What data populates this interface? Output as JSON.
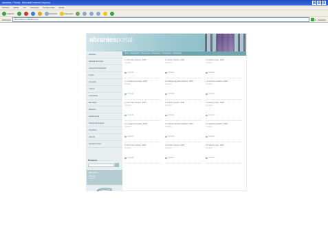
{
  "window": {
    "title": "abrantes * Portal - Microsoft Internet Explorer",
    "controls": [
      "_",
      "□",
      "x"
    ]
  },
  "menu": [
    "Ficheiro",
    "Editar",
    "Ver",
    "Favoritos",
    "Ferramentas",
    "Ajuda"
  ],
  "toolbar": {
    "back_label": "Anterior",
    "search_label": "Procurar",
    "favorites_label": "Favoritos"
  },
  "address": {
    "label": "Endereço",
    "url": "http://www.cm-abrantes.pt",
    "go_label": "Ir",
    "links_label": "Ligações"
  },
  "site": {
    "logo_bold": "abrantes",
    "logo_light": "portal",
    "breadcrumb": "Início > Municípios > Municípios > Municípios > Municípios > Municípios",
    "nav": [
      "Abrantes",
      "Câmara Municipal",
      "Assembleia Municipal",
      "Juntas",
      "Concelho",
      "Cultura",
      "Actividades",
      "Educação",
      "Desporto",
      "Acção Social",
      "Notícias Municipais",
      "Contactos",
      "Agenda",
      "Serviços Online"
    ],
    "search": {
      "label": "Pesquisa",
      "placeholder": ""
    },
    "members": {
      "label": "Membros",
      "line1": "Utilizador",
      "line2": "Registar"
    },
    "cards": [
      {
        "title": "1.1 Rui Vaz Carreiro, 2005",
        "sub": "Vereador",
        "more": "Consulte"
      },
      {
        "title": "1.2 Pedro Santos, 2005",
        "sub": "Vereador",
        "more": "Consulte"
      },
      {
        "title": "1.3 Maria Lopes, 2005",
        "sub": "Vereador",
        "more": "Consulte"
      },
      {
        "title": "1.4 Joaquim Cerveira, 2005",
        "sub": "Vereador",
        "more": "Consulte"
      },
      {
        "title": "1.5 Manuel da Silva Martins, 2005",
        "sub": "Vereador",
        "more": "Consulte"
      },
      {
        "title": "1.6 António Cordeiro, 2005",
        "sub": "Vereador",
        "more": "Consulte"
      },
      {
        "title": "1.7 Rui Vaz Carreiro, 2005",
        "sub": "Vereador",
        "more": "Consulte"
      },
      {
        "title": "1.8 Pedro Santos, 2005",
        "sub": "Vereador",
        "more": "Consulte"
      },
      {
        "title": "1.9 Maria Lopes, 2005",
        "sub": "Vereador",
        "more": "Consulte"
      },
      {
        "title": "2.0 Joaquim Cerveira, 2005",
        "sub": "Vereador",
        "more": "Consulte"
      },
      {
        "title": "2.1 Manuel da Silva Martins, 2005",
        "sub": "Vereador",
        "more": "Consulte"
      },
      {
        "title": "2.2 António Cordeiro, 2005",
        "sub": "Vereador",
        "more": "Consulte"
      },
      {
        "title": "2.3 Rui Vaz Carreiro, 2005",
        "sub": "Vereador",
        "more": "Consulte"
      },
      {
        "title": "2.4 Pedro Santos, 2005",
        "sub": "Vereador",
        "more": "Consulte"
      },
      {
        "title": "2.5 Maria Lopes, 2005",
        "sub": "Vereador",
        "more": "Consulte"
      }
    ]
  },
  "colors": {
    "accent": "#6ea5b1",
    "sidebar": "#e9eff1",
    "title_bar": "#1f4fbf"
  }
}
